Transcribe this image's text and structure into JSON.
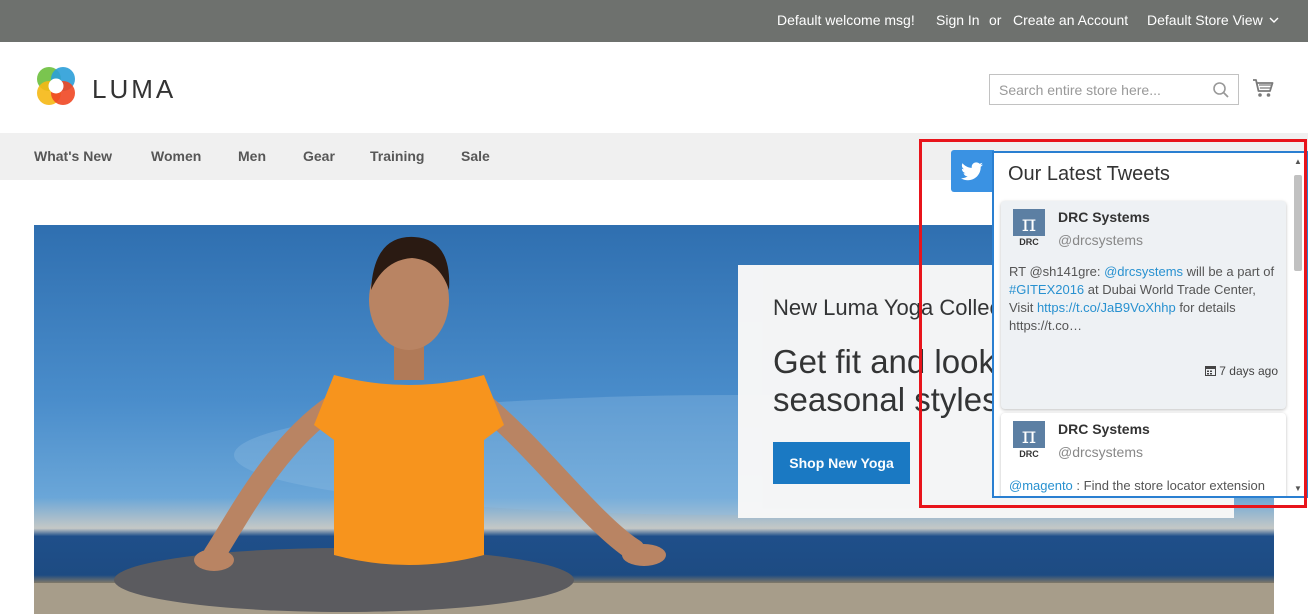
{
  "topbar": {
    "welcome": "Default welcome msg!",
    "sign_in": "Sign In",
    "or": "or",
    "create_account": "Create an Account",
    "store_view": "Default Store View"
  },
  "header": {
    "logo_text": "LUMA",
    "search_placeholder": "Search entire store here...",
    "icons": {
      "search": "search-icon",
      "cart": "cart-icon"
    }
  },
  "nav": {
    "items": [
      "What's New",
      "Women",
      "Men",
      "Gear",
      "Training",
      "Sale"
    ]
  },
  "hero": {
    "subtitle": "New Luma Yoga Collection",
    "title": "Get fit and look good in seasonal styles",
    "button": "Shop New Yoga"
  },
  "twitter": {
    "title": "Our Latest Tweets",
    "button_icon": "twitter-bird-icon",
    "tweets": [
      {
        "name": "DRC Systems",
        "handle": "@drcsystems",
        "text_parts": [
          "RT @sh141gre: ",
          "@drcsystems",
          " will be a part of ",
          "#GITEX2016",
          " at Dubai World Trade Center, Visit ",
          "https://t.co/JaB9VoXhhp",
          " for details https://t.co…"
        ],
        "time": "7 days ago"
      },
      {
        "name": "DRC Systems",
        "handle": "@drcsystems",
        "text_parts": [
          "@magento",
          " : Find the store locator extension"
        ]
      }
    ]
  },
  "colors": {
    "topbar_bg": "#6e716e",
    "nav_bg": "#f0f0f0",
    "primary_button": "#1979c3",
    "twitter_blue": "#3a92e3",
    "link_blue": "#2891d0",
    "highlight_red": "#e8141b"
  }
}
